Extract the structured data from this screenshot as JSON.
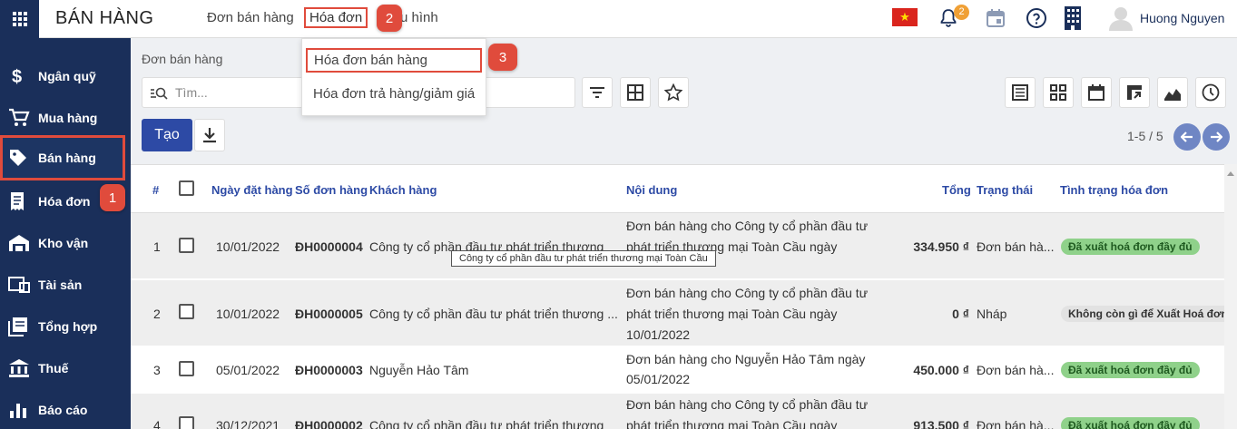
{
  "app": {
    "title": "BÁN HÀNG",
    "menu": {
      "orders": "Đơn bán hàng",
      "invoices": "Hóa đơn",
      "config": "u hình"
    },
    "notification_count": "2",
    "user_name": "Huong Nguyen"
  },
  "sidebar": {
    "items": [
      {
        "label": "Ngân quỹ"
      },
      {
        "label": "Mua hàng"
      },
      {
        "label": "Bán hàng"
      },
      {
        "label": "Hóa đơn"
      },
      {
        "label": "Kho vận"
      },
      {
        "label": "Tài sản"
      },
      {
        "label": "Tổng hợp"
      },
      {
        "label": "Thuế"
      },
      {
        "label": "Báo cáo"
      }
    ]
  },
  "callouts": {
    "one": "1",
    "two": "2",
    "three": "3"
  },
  "dropdown": {
    "items": [
      {
        "label": "Hóa đơn bán hàng"
      },
      {
        "label": "Hóa đơn trả hàng/giảm giá"
      }
    ]
  },
  "control": {
    "breadcrumb": "Đơn bán hàng",
    "search_placeholder": "Tìm...",
    "create_label": "Tạo",
    "pager": "1-5 / 5"
  },
  "table": {
    "headers": {
      "index": "#",
      "date": "Ngày đặt hàng",
      "number": "Số đơn hàng",
      "customer": "Khách hàng",
      "content": "Nội dung",
      "total": "Tổng",
      "status": "Trạng thái",
      "invoice_status": "Tình trạng hóa đơn"
    },
    "rows": [
      {
        "index": "1",
        "date": "10/01/2022",
        "number": "ĐH0000004",
        "customer": "Công ty cổ phần đầu tư phát triển thương",
        "content1": "Đơn bán hàng cho Công ty cổ phần đầu tư",
        "content2": "phát triển thương mại Toàn Cầu ngày",
        "content3": "",
        "total": "334.950 ₫",
        "status": "Đơn bán hà...",
        "invoice_status": "Đã xuất hoá đơn đầy đủ"
      },
      {
        "index": "2",
        "date": "10/01/2022",
        "number": "ĐH0000005",
        "customer": "Công ty cổ phần đầu tư phát triển thương ...",
        "content1": "Đơn bán hàng cho Công ty cổ phần đầu tư",
        "content2": "phát triển thương mại Toàn Cầu ngày",
        "content3": "10/01/2022",
        "total": "0 ₫",
        "status": "Nháp",
        "invoice_status": "Không còn gì để Xuất Hoá đơn"
      },
      {
        "index": "3",
        "date": "05/01/2022",
        "number": "ĐH0000003",
        "customer": "Nguyễn Hảo Tâm",
        "content1": "Đơn bán hàng cho Nguyễn Hảo Tâm ngày",
        "content2": "05/01/2022",
        "content3": "",
        "total": "450.000 ₫",
        "status": "Đơn bán hà...",
        "invoice_status": "Đã xuất hoá đơn đầy đủ"
      },
      {
        "index": "4",
        "date": "30/12/2021",
        "number": "ĐH0000002",
        "customer": "Công ty cổ phần đầu tư phát triển thương",
        "content1": "Đơn bán hàng cho Công ty cổ phần đầu tư",
        "content2": "phát triển thương mại Toàn Cầu ngày",
        "content3": "",
        "total": "913.500 ₫",
        "status": "Đơn bán hà...",
        "invoice_status": "Đã xuất hoá đơn đầy đủ"
      }
    ],
    "tooltip": "Công ty cổ phần đầu tư phát triển thương mại Toàn Cầu"
  },
  "colors": {
    "sidebar_bg": "#1a2f5a",
    "primary": "#2d4aa5",
    "highlight": "#e04b3c",
    "badge_green": "#8fd18a"
  }
}
